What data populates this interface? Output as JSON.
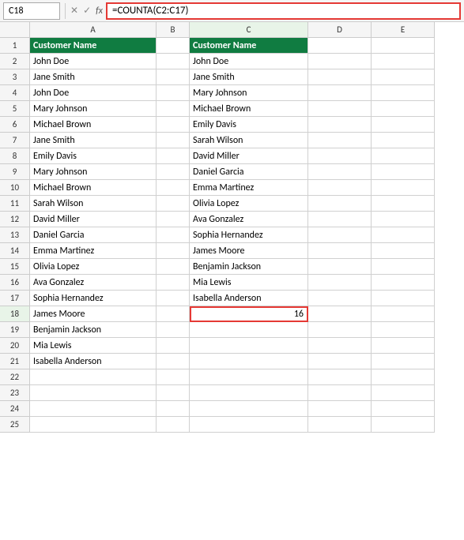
{
  "formulaBar": {
    "cellRef": "C18",
    "formula": "=COUNTA(C2:C17)",
    "fxLabel": "fx"
  },
  "columns": [
    "",
    "A",
    "B",
    "C",
    "D",
    "E"
  ],
  "colAHeader": "Customer Name",
  "colCHeader": "Customer Name",
  "colAData": [
    "John Doe",
    "Jane Smith",
    "John Doe",
    "Mary Johnson",
    "Michael Brown",
    "Jane Smith",
    "Emily Davis",
    "Mary Johnson",
    "Michael Brown",
    "Sarah Wilson",
    "David Miller",
    "Daniel Garcia",
    "Emma Martinez",
    "Olivia Lopez",
    "Ava Gonzalez",
    "Sophia Hernandez",
    "James Moore",
    "Benjamin Jackson",
    "Mia Lewis",
    "Isabella Anderson",
    "",
    "",
    "",
    ""
  ],
  "colCData": [
    "John Doe",
    "Jane Smith",
    "Mary Johnson",
    "Michael Brown",
    "Emily Davis",
    "Sarah Wilson",
    "David Miller",
    "Daniel Garcia",
    "Emma Martinez",
    "Olivia Lopez",
    "Ava Gonzalez",
    "Sophia Hernandez",
    "James Moore",
    "Benjamin Jackson",
    "Mia Lewis",
    "Isabella Anderson",
    "16",
    "",
    "",
    "",
    "",
    "",
    "",
    ""
  ],
  "selectedCell": "C18",
  "countResult": "16",
  "totalRows": 25
}
